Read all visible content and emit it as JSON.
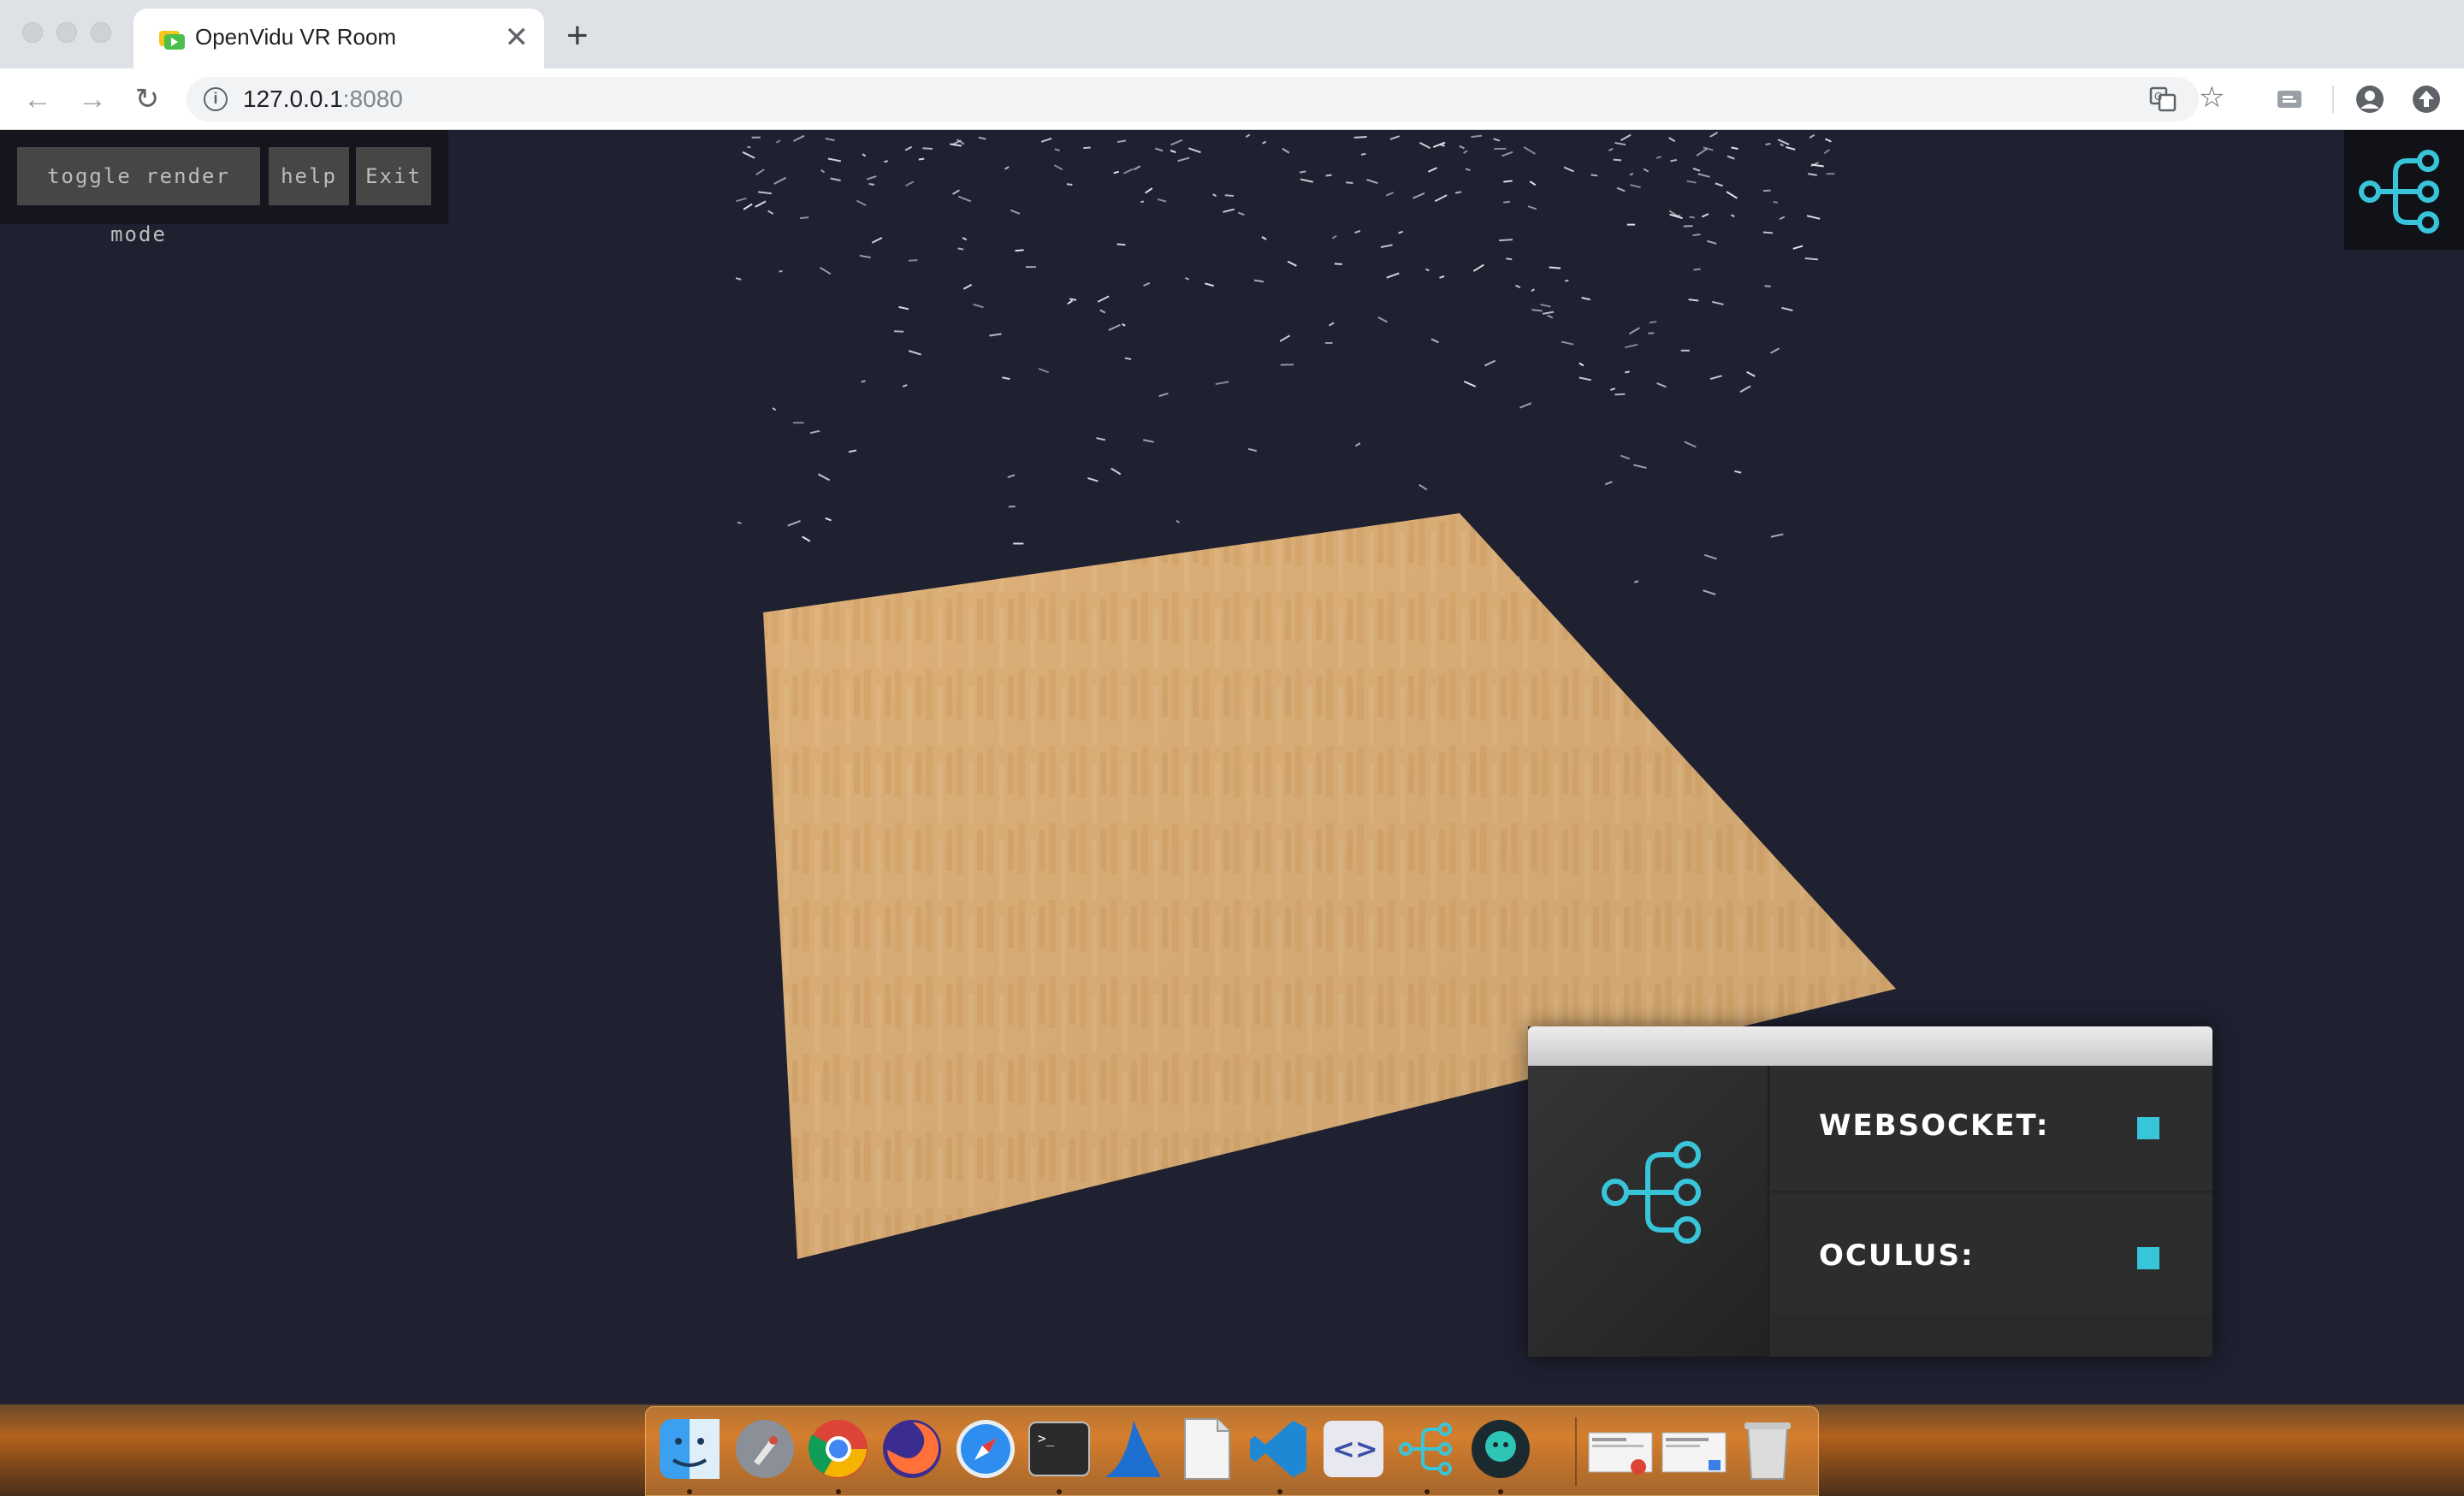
{
  "browser": {
    "tab_title": "OpenVidu VR Room",
    "tab_close": "✕",
    "new_tab": "+",
    "url_host": "127.0.0.1",
    "url_port": ":8080",
    "info_icon": "i"
  },
  "toolbar_icons": [
    "back-arrow-icon",
    "forward-arrow-icon",
    "reload-icon",
    "translate-icon",
    "bookmark-star-icon",
    "cast-icon",
    "account-icon",
    "update-icon"
  ],
  "nav": {
    "back": "←",
    "forward": "→",
    "reload": "↻",
    "star": "☆"
  },
  "controls": {
    "toggle_render_mode": "toggle render mode",
    "help": "help",
    "exit": "Exit"
  },
  "status": {
    "websocket_label": "WEBSOCKET:",
    "oculus_label": "OCULUS:"
  },
  "colors": {
    "accent": "#39c5d9",
    "scene_bg": "#1f2030",
    "floor": "#e7b67a"
  },
  "dock_apps": [
    "finder-icon",
    "launchpad-icon",
    "chrome-icon",
    "firefox-icon",
    "safari-icon",
    "terminal-icon",
    "wireshark-icon",
    "document-icon",
    "vscode-icon",
    "code-editor-icon",
    "openvidu-icon",
    "gitkraken-icon",
    "window-preview-icon",
    "window-preview-icon",
    "trash-icon"
  ]
}
